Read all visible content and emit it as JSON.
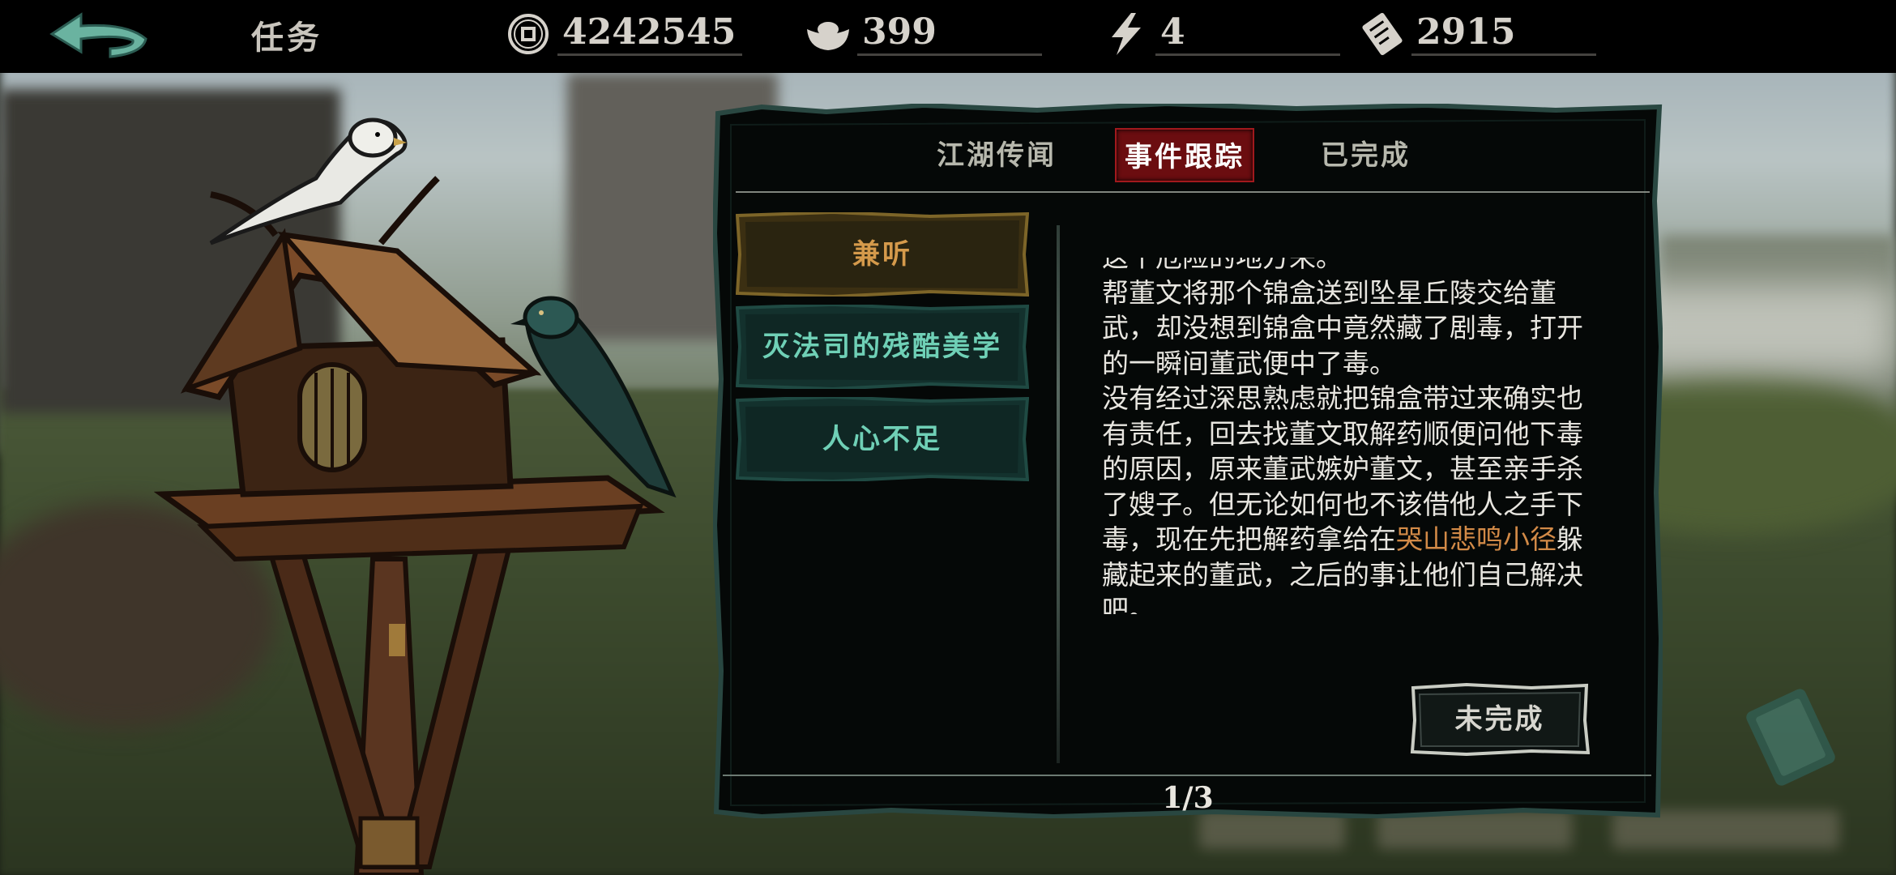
{
  "topbar": {
    "title": "任务",
    "coins": "4242545",
    "silver": "399",
    "energy": "4",
    "tickets": "2915"
  },
  "tabs": [
    "江湖传闻",
    "事件跟踪",
    "已完成"
  ],
  "active_tab": "事件跟踪",
  "quests": [
    "兼听",
    "灭法司的残酷美学",
    "人心不足"
  ],
  "active_quest": "兼听",
  "description": {
    "partial_line": "这个危险的地方来。",
    "para1": "帮董文将那个锦盒送到坠星丘陵交给董武，却没想到锦盒中竟然藏了剧毒，打开的一瞬间董武便中了毒。",
    "para2_before": "没有经过深思熟虑就把锦盒带过来确实也有责任，回去找董文取解药顺便问他下毒的原因，原来董武嫉妒董文，甚至亲手杀了嫂子。但无论如何也不该借他人之手下毒，现在先把解药拿给在",
    "para2_highlight": "哭山悲鸣小径",
    "para2_after": "躲藏起来的董武，之后的事让他们自己解决吧。"
  },
  "status_button": "未完成",
  "page_indicator": "1/3",
  "colors": {
    "active_tab_bg": "#6b0d10",
    "quest_active_text": "#d59a4b",
    "quest_text": "#6fd0b6",
    "location_highlight": "#d28a47",
    "panel_bg": "#050807"
  },
  "icons": [
    "back-arrow-icon",
    "copper-coin-icon",
    "silver-ingot-icon",
    "lightning-icon",
    "ticket-icon"
  ]
}
